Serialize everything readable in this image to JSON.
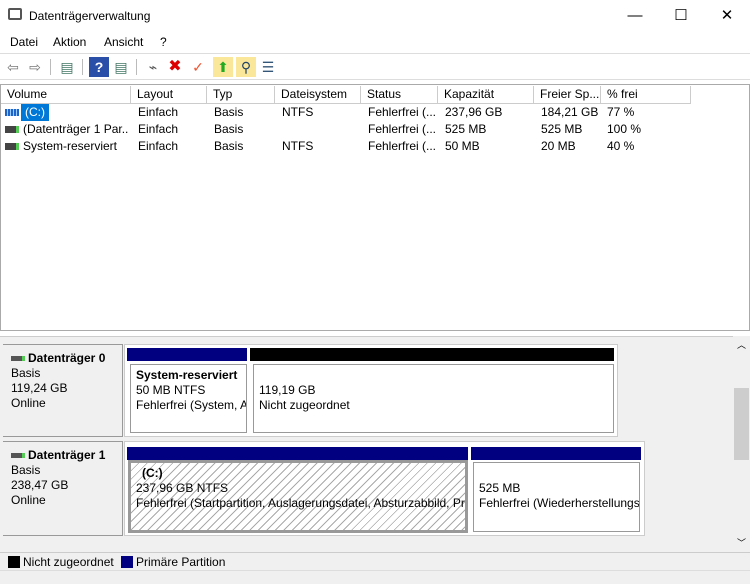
{
  "window": {
    "title": "Datenträgerverwaltung",
    "minimize": "—",
    "maximize": "☐",
    "close": "✕"
  },
  "menu": [
    "Datei",
    "Aktion",
    "Ansicht",
    "?"
  ],
  "toolbar": [
    {
      "icon": "back-icon",
      "glyph": "⇦"
    },
    {
      "icon": "forward-icon",
      "glyph": "⇨"
    },
    {
      "icon": "show-hide-console-tree-icon",
      "glyph": "▤"
    },
    {
      "icon": "help-icon",
      "glyph": "?"
    },
    {
      "icon": "show-action-pane-icon",
      "glyph": "▤"
    },
    {
      "icon": "connect-drive-icon",
      "glyph": "⌁"
    },
    {
      "icon": "delete-icon",
      "glyph": "✖"
    },
    {
      "icon": "check-icon",
      "glyph": "✓"
    },
    {
      "icon": "folder-up-icon",
      "glyph": "⬆"
    },
    {
      "icon": "folder-search-icon",
      "glyph": "⚲"
    },
    {
      "icon": "properties-icon",
      "glyph": "☰"
    }
  ],
  "columns": [
    "Volume",
    "Layout",
    "Typ",
    "Dateisystem",
    "Status",
    "Kapazität",
    "Freier Sp...",
    "% frei"
  ],
  "rows": [
    [
      "(C:)",
      "Einfach",
      "Basis",
      "NTFS",
      "Fehlerfrei (...",
      "237,96 GB",
      "184,21 GB",
      "77 %"
    ],
    [
      "(Datenträger 1 Par...",
      "Einfach",
      "Basis",
      "",
      "Fehlerfrei (...",
      "525 MB",
      "525 MB",
      "100 %"
    ],
    [
      "System-reserviert",
      "Einfach",
      "Basis",
      "NTFS",
      "Fehlerfrei (...",
      "50 MB",
      "20 MB",
      "40 %"
    ]
  ],
  "disks": [
    {
      "name": "Datenträger 0",
      "type": "Basis",
      "size": "119,24 GB",
      "state": "Online",
      "partitions": [
        {
          "title": "System-reserviert",
          "size": "50 MB NTFS",
          "status": "Fehlerfrei (System, A"
        },
        {
          "title": "",
          "size": "119,19 GB",
          "status": "Nicht zugeordnet"
        }
      ]
    },
    {
      "name": "Datenträger 1",
      "type": "Basis",
      "size": "238,47 GB",
      "state": "Online",
      "partitions": [
        {
          "title": "(C:)",
          "size": "237,96 GB NTFS",
          "status": "Fehlerfrei (Startpartition, Auslagerungsdatei, Absturzabbild, Pri"
        },
        {
          "title": "",
          "size": "525 MB",
          "status": "Fehlerfrei (Wiederherstellungs"
        }
      ]
    }
  ],
  "legend": [
    {
      "label": "Nicht zugeordnet",
      "color": "#000000"
    },
    {
      "label": "Primäre Partition",
      "color": "#000080"
    }
  ],
  "colors": {
    "primary": "#000080",
    "unallocated": "#000000",
    "selection": "#0078d7"
  }
}
